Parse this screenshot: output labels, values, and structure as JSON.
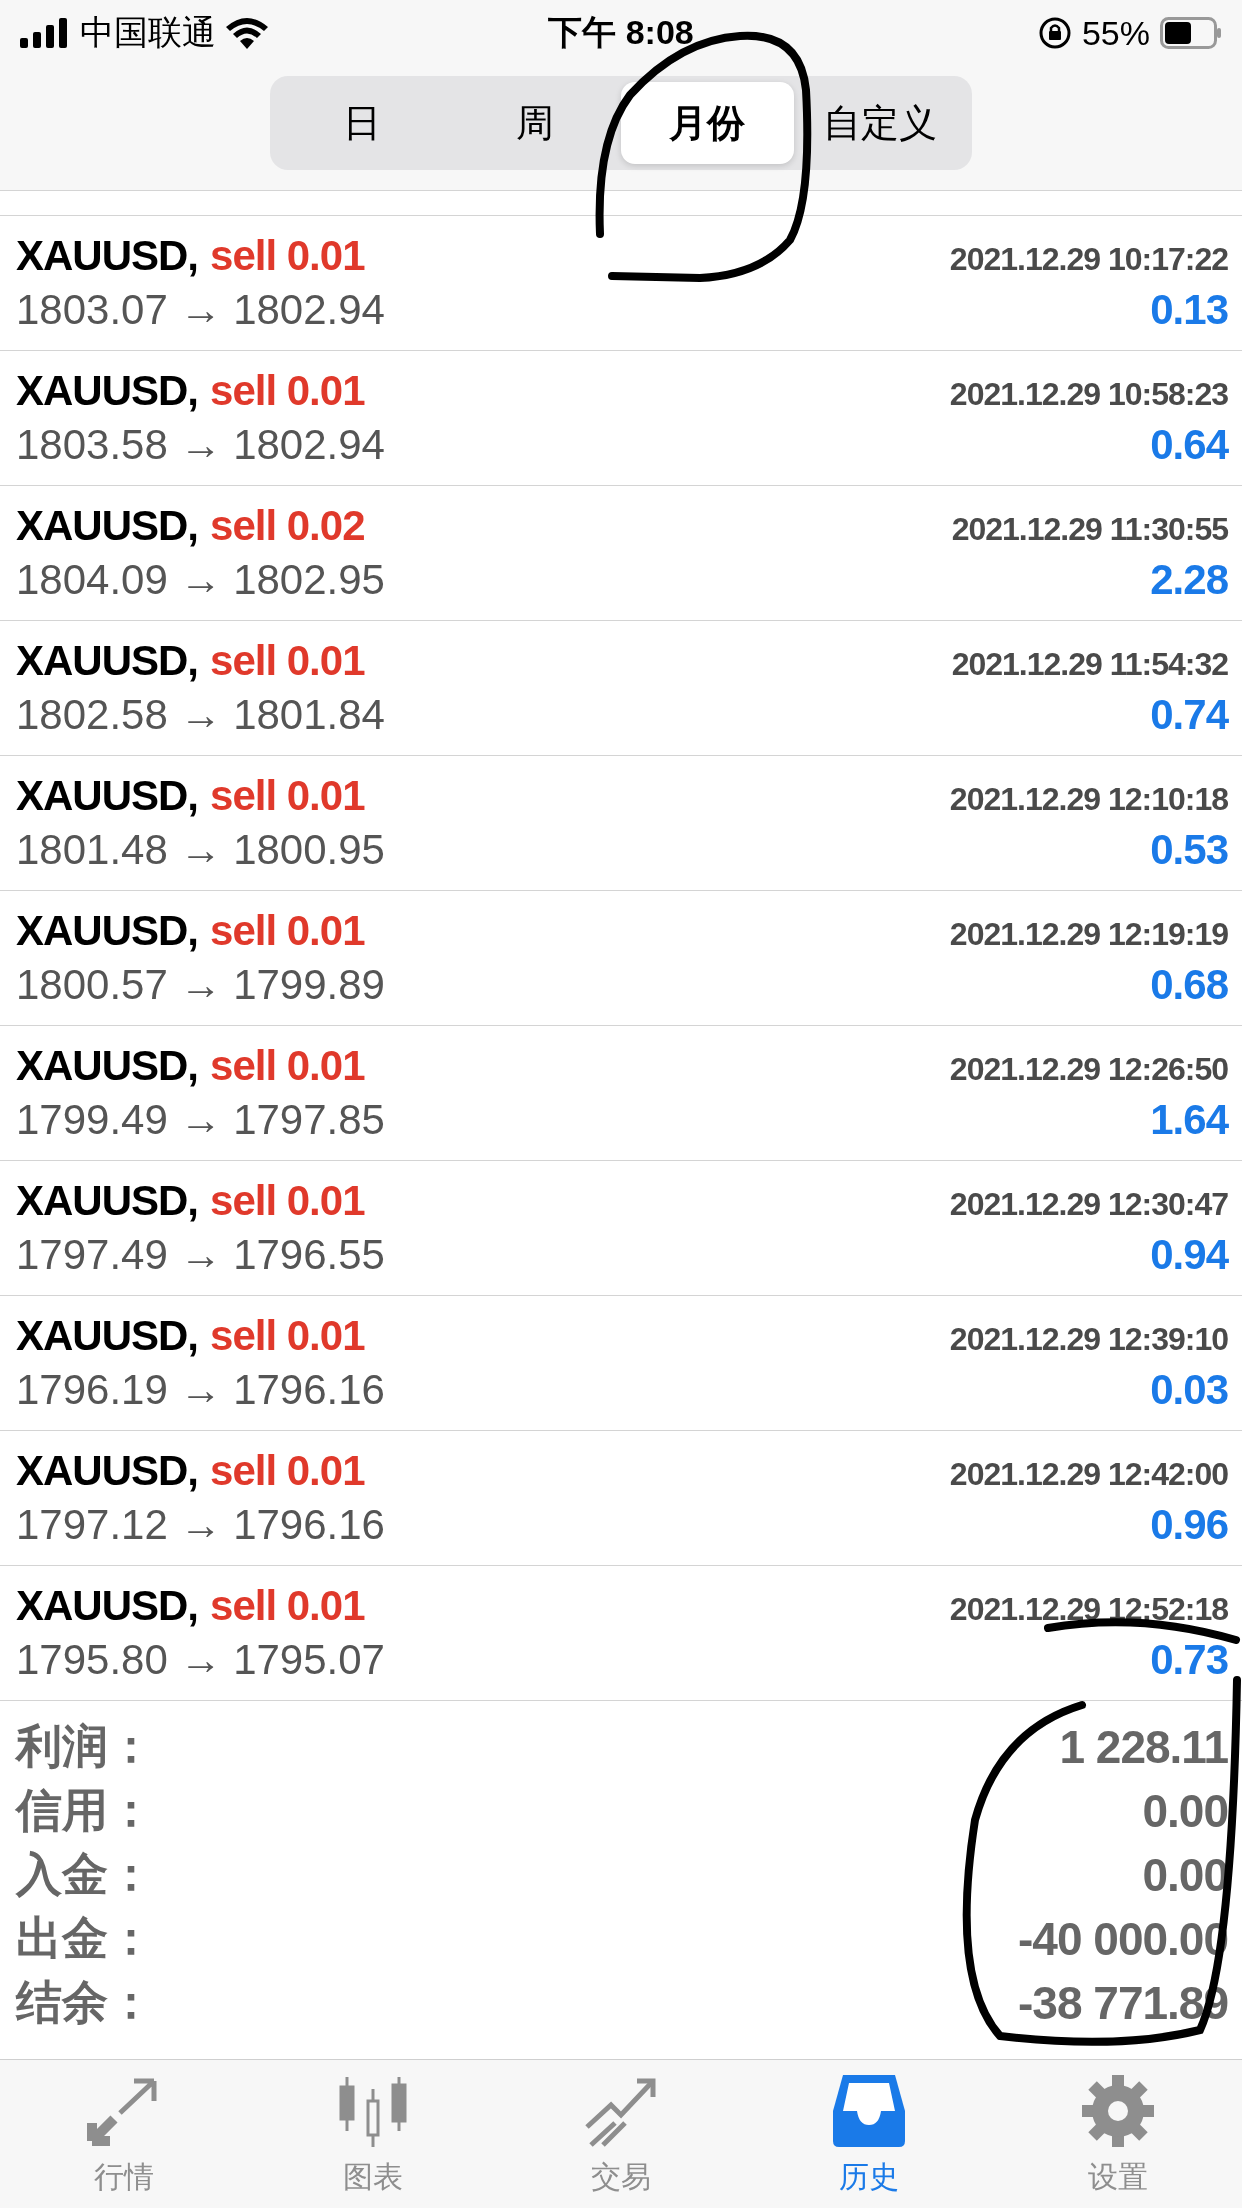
{
  "status_bar": {
    "carrier": "中国联通",
    "time": "下午 8:08",
    "battery": "55%"
  },
  "period_tabs": [
    {
      "label": "日",
      "selected": false
    },
    {
      "label": "周",
      "selected": false
    },
    {
      "label": "月份",
      "selected": true
    },
    {
      "label": "自定义",
      "selected": false
    }
  ],
  "trades": [
    {
      "symbol": "XAUUSD,",
      "side": "sell 0.01",
      "time": "2021.12.29 10:17:22",
      "prices": "1803.07 → 1802.94",
      "profit": "0.13"
    },
    {
      "symbol": "XAUUSD,",
      "side": "sell 0.01",
      "time": "2021.12.29 10:58:23",
      "prices": "1803.58 → 1802.94",
      "profit": "0.64"
    },
    {
      "symbol": "XAUUSD,",
      "side": "sell 0.02",
      "time": "2021.12.29 11:30:55",
      "prices": "1804.09 → 1802.95",
      "profit": "2.28"
    },
    {
      "symbol": "XAUUSD,",
      "side": "sell 0.01",
      "time": "2021.12.29 11:54:32",
      "prices": "1802.58 → 1801.84",
      "profit": "0.74"
    },
    {
      "symbol": "XAUUSD,",
      "side": "sell 0.01",
      "time": "2021.12.29 12:10:18",
      "prices": "1801.48 → 1800.95",
      "profit": "0.53"
    },
    {
      "symbol": "XAUUSD,",
      "side": "sell 0.01",
      "time": "2021.12.29 12:19:19",
      "prices": "1800.57 → 1799.89",
      "profit": "0.68"
    },
    {
      "symbol": "XAUUSD,",
      "side": "sell 0.01",
      "time": "2021.12.29 12:26:50",
      "prices": "1799.49 → 1797.85",
      "profit": "1.64"
    },
    {
      "symbol": "XAUUSD,",
      "side": "sell 0.01",
      "time": "2021.12.29 12:30:47",
      "prices": "1797.49 → 1796.55",
      "profit": "0.94"
    },
    {
      "symbol": "XAUUSD,",
      "side": "sell 0.01",
      "time": "2021.12.29 12:39:10",
      "prices": "1796.19 → 1796.16",
      "profit": "0.03"
    },
    {
      "symbol": "XAUUSD,",
      "side": "sell 0.01",
      "time": "2021.12.29 12:42:00",
      "prices": "1797.12 → 1796.16",
      "profit": "0.96"
    },
    {
      "symbol": "XAUUSD,",
      "side": "sell 0.01",
      "time": "2021.12.29 12:52:18",
      "prices": "1795.80 → 1795.07",
      "profit": "0.73"
    }
  ],
  "summary": [
    {
      "label": "利润：",
      "value": "1 228.11"
    },
    {
      "label": "信用：",
      "value": "0.00"
    },
    {
      "label": "入金：",
      "value": "0.00"
    },
    {
      "label": "出金：",
      "value": "-40 000.00"
    },
    {
      "label": "结余：",
      "value": "-38 771.89"
    }
  ],
  "tab_bar": [
    {
      "label": "行情",
      "selected": false
    },
    {
      "label": "图表",
      "selected": false
    },
    {
      "label": "交易",
      "selected": false
    },
    {
      "label": "历史",
      "selected": true
    },
    {
      "label": "设置",
      "selected": false
    }
  ]
}
